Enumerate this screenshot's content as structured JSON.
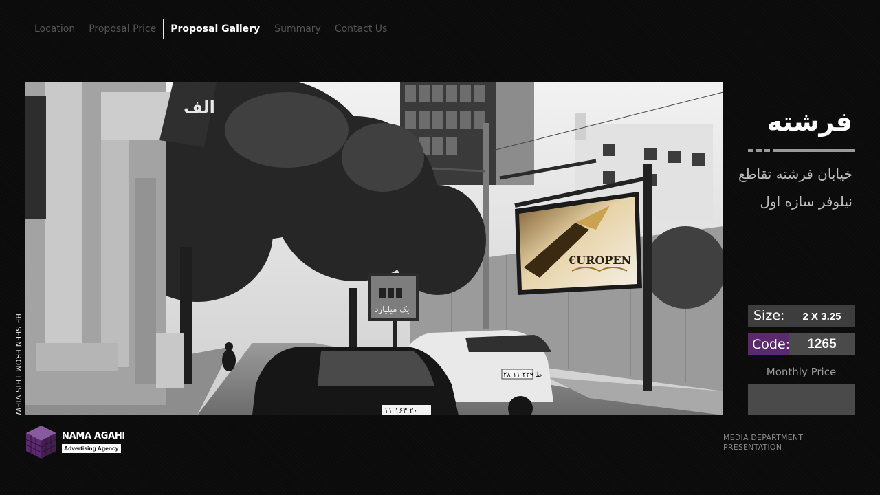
{
  "nav": {
    "items": [
      {
        "label": "Location",
        "active": false
      },
      {
        "label": "Proposal Price",
        "active": false
      },
      {
        "label": "Proposal Gallery",
        "active": true
      },
      {
        "label": "Summary",
        "active": false
      },
      {
        "label": "Contact Us",
        "active": false
      }
    ]
  },
  "photo": {
    "side_caption": "BE SEEN FROM THIS VIEW",
    "billboard_brand": "€UROPEN",
    "left_banner_text": "الف",
    "small_billboard_text": "یک میلیارد",
    "plate_white_car": "۲۸ ط ۲۲۹ ۱۱",
    "plate_black_car": "۱۱ ۱۶۳ ۲۰"
  },
  "location": {
    "title": "فرشته",
    "address": "خیابان فرشته تقاطع نیلوفر سازه اول"
  },
  "specs": {
    "size_label": "Size:",
    "size_value": "2 X 3.25",
    "code_label": "Code:",
    "code_value": "1265",
    "monthly_price_label": "Monthly Price",
    "monthly_price_value": ""
  },
  "footer": {
    "brand_name": "NAMA AGAHI",
    "brand_tagline": "Advertising Agency",
    "note_line1": "MEDIA DEPARTMENT",
    "note_line2": "PRESENTATION"
  },
  "colors": {
    "accent_purple": "#5b2a6e",
    "panel_gray": "#4a4a4a",
    "nav_inactive": "#555555"
  }
}
